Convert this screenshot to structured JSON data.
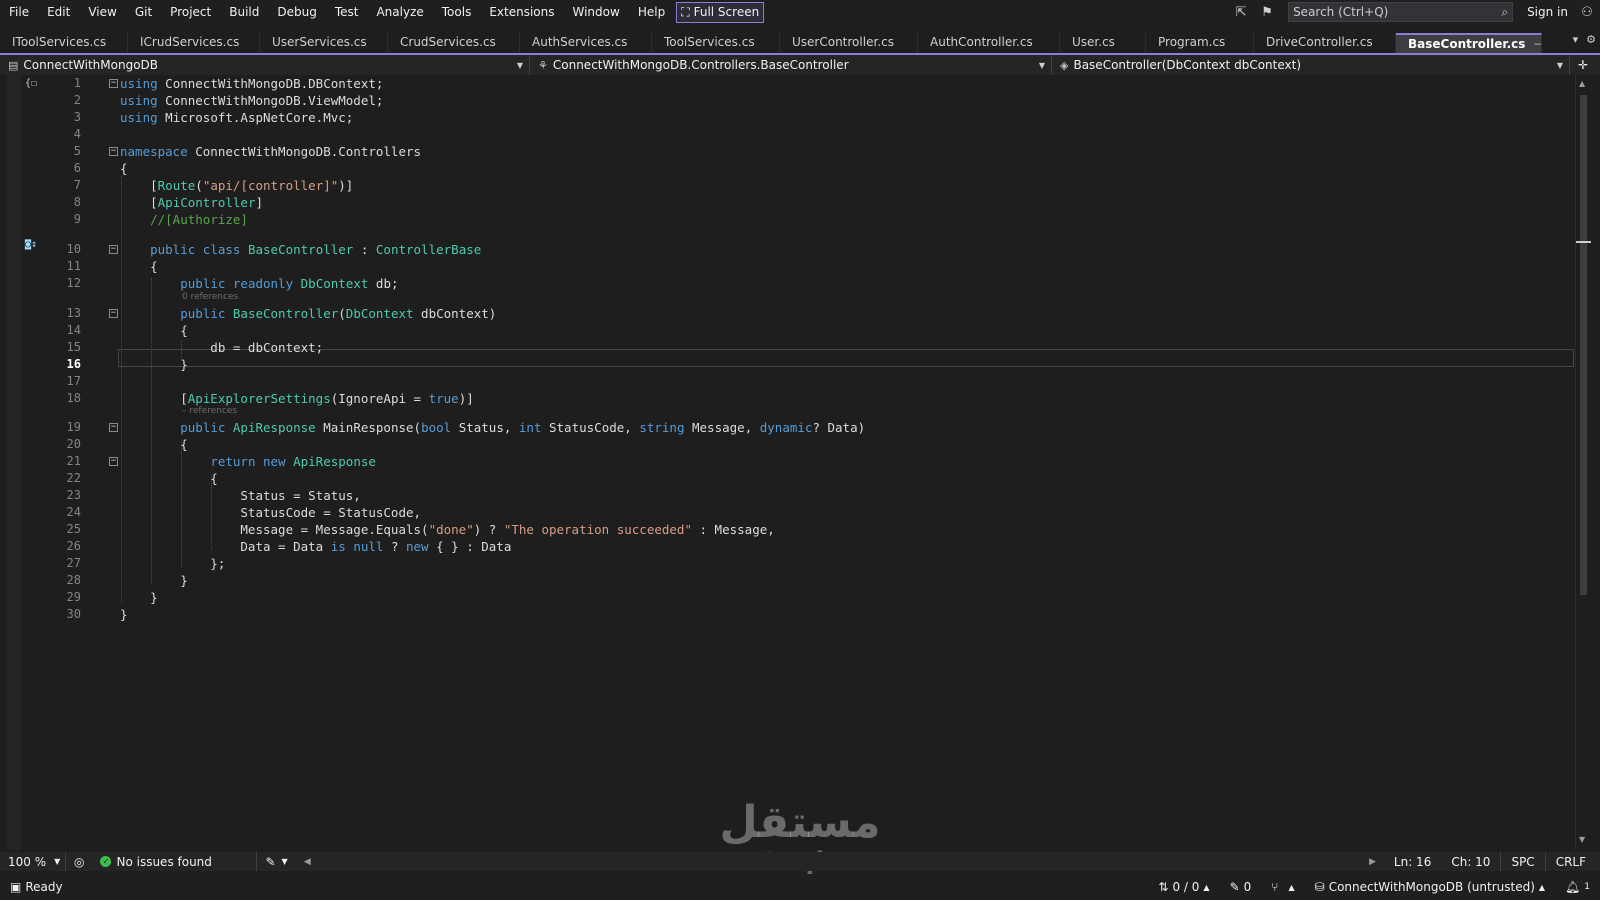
{
  "menu": {
    "items": [
      "File",
      "Edit",
      "View",
      "Git",
      "Project",
      "Build",
      "Debug",
      "Test",
      "Analyze",
      "Tools",
      "Extensions",
      "Window",
      "Help"
    ],
    "fullscreen_label": "Full Screen",
    "search_placeholder": "Search (Ctrl+Q)",
    "signin_label": "Sign in"
  },
  "tabs": [
    {
      "label": "IToolServices.cs",
      "width": 128
    },
    {
      "label": "ICrudServices.cs",
      "width": 132
    },
    {
      "label": "UserServices.cs",
      "width": 128
    },
    {
      "label": "CrudServices.cs",
      "width": 132
    },
    {
      "label": "AuthServices.cs",
      "width": 132
    },
    {
      "label": "ToolServices.cs",
      "width": 128
    },
    {
      "label": "UserController.cs",
      "width": 138
    },
    {
      "label": "AuthController.cs",
      "width": 142
    },
    {
      "label": "User.cs",
      "width": 86
    },
    {
      "label": "Program.cs",
      "width": 108
    },
    {
      "label": "DriveController.cs",
      "width": 142
    }
  ],
  "active_tab": {
    "label": "BaseController.cs"
  },
  "navbar": {
    "project": "ConnectWithMongoDB",
    "class_path": "ConnectWithMongoDB.Controllers.BaseController",
    "member": "BaseController(DbContext dbContext)"
  },
  "editor": {
    "line_numbers": [
      "1",
      "2",
      "3",
      "4",
      "5",
      "6",
      "7",
      "8",
      "9",
      "10",
      "11",
      "12",
      "13",
      "14",
      "15",
      "16",
      "17",
      "18",
      "19",
      "20",
      "21",
      "22",
      "23",
      "24",
      "25",
      "26",
      "27",
      "28",
      "29",
      "30"
    ],
    "current_line": "16",
    "codelens_13": "0 references",
    "codelens_19": "– references"
  },
  "bottom": {
    "zoom": "100 %",
    "issues": "No issues found",
    "ln": "Ln: 16",
    "ch": "Ch: 10",
    "spc": "SPC",
    "eol": "CRLF"
  },
  "status": {
    "ready": "Ready",
    "sync": "0 / 0",
    "pencil_count": "0",
    "repo": "ConnectWithMongoDB (untrusted)",
    "notifications": "1"
  },
  "watermark": {
    "arabic": "مستقل",
    "latin": "mostaql.com"
  }
}
